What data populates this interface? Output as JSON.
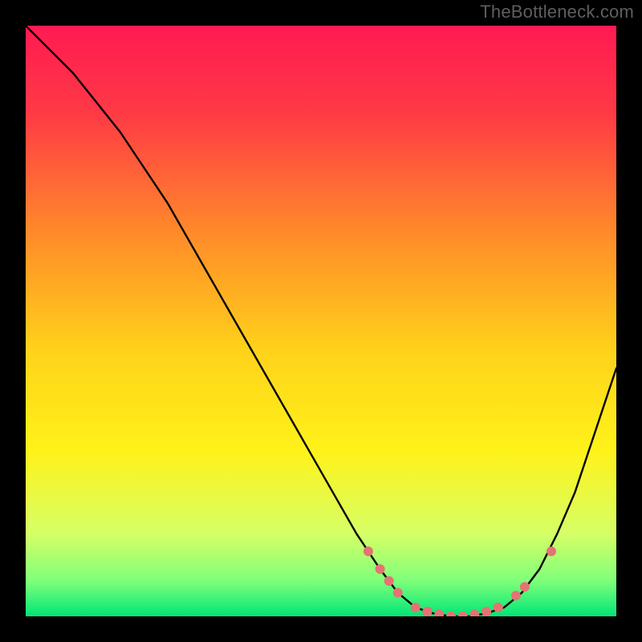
{
  "watermark": "TheBottleneck.com",
  "chart_data": {
    "type": "line",
    "title": "",
    "xlabel": "",
    "ylabel": "",
    "xlim": [
      0,
      100
    ],
    "ylim": [
      0,
      100
    ],
    "grid": false,
    "legend": false,
    "background_gradient": {
      "stops": [
        {
          "offset": 0.0,
          "color": "#ff1a52"
        },
        {
          "offset": 0.15,
          "color": "#ff3a45"
        },
        {
          "offset": 0.35,
          "color": "#ff8a2a"
        },
        {
          "offset": 0.55,
          "color": "#ffd21a"
        },
        {
          "offset": 0.72,
          "color": "#fff21a"
        },
        {
          "offset": 0.86,
          "color": "#d6ff66"
        },
        {
          "offset": 0.94,
          "color": "#7fff7a"
        },
        {
          "offset": 1.0,
          "color": "#00e676"
        }
      ]
    },
    "series": [
      {
        "name": "bottleneck-curve",
        "stroke": "#000000",
        "stroke_width": 2.4,
        "x": [
          0,
          4,
          8,
          12,
          16,
          20,
          24,
          28,
          32,
          36,
          40,
          44,
          48,
          52,
          56,
          60,
          63,
          66,
          69,
          72,
          75,
          78,
          81,
          84,
          87,
          90,
          93,
          96,
          100
        ],
        "y": [
          100,
          96,
          92,
          87,
          82,
          76,
          70,
          63,
          56,
          49,
          42,
          35,
          28,
          21,
          14,
          8,
          4,
          1.5,
          0.5,
          0,
          0,
          0.5,
          1.5,
          4,
          8,
          14,
          21,
          30,
          42
        ]
      }
    ],
    "markers": {
      "name": "highlight-dots",
      "fill": "#e57373",
      "radius": 6,
      "points": [
        {
          "x": 58,
          "y": 11
        },
        {
          "x": 60,
          "y": 8
        },
        {
          "x": 61.5,
          "y": 6
        },
        {
          "x": 63,
          "y": 4
        },
        {
          "x": 66,
          "y": 1.5
        },
        {
          "x": 68,
          "y": 0.8
        },
        {
          "x": 70,
          "y": 0.3
        },
        {
          "x": 72,
          "y": 0
        },
        {
          "x": 74,
          "y": 0
        },
        {
          "x": 76,
          "y": 0.3
        },
        {
          "x": 78,
          "y": 0.8
        },
        {
          "x": 80,
          "y": 1.5
        },
        {
          "x": 83,
          "y": 3.5
        },
        {
          "x": 84.5,
          "y": 5
        },
        {
          "x": 89,
          "y": 11
        }
      ]
    }
  }
}
